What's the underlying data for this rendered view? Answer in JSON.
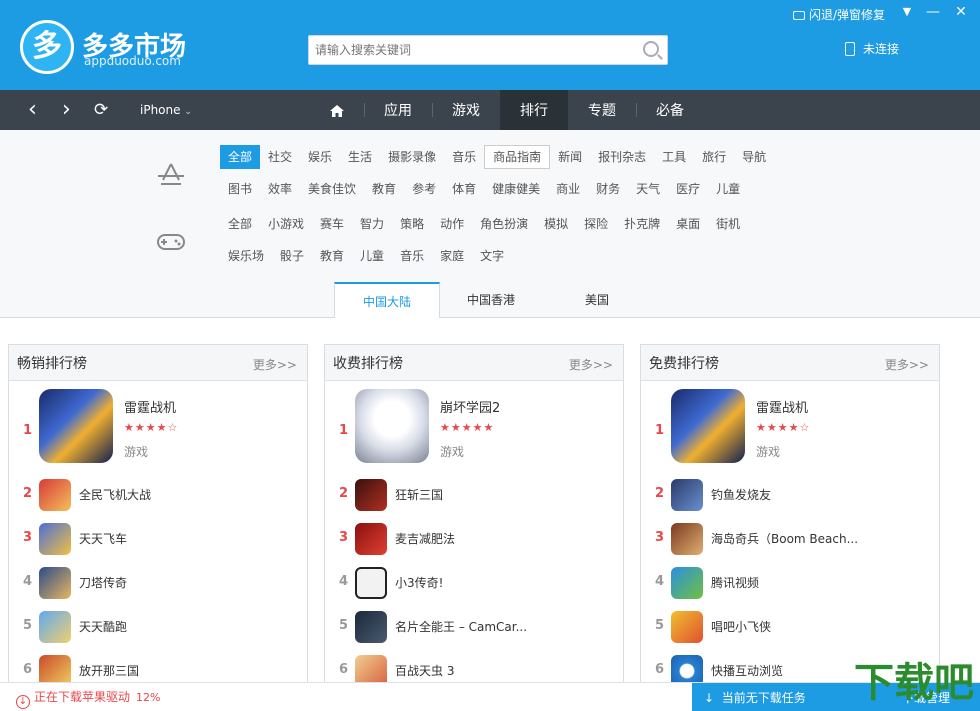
{
  "app": {
    "logo_char": "多",
    "title": "多多市场",
    "subtitle": "appduoduo.com"
  },
  "search": {
    "placeholder": "请输入搜索关键词"
  },
  "window": {
    "flash_label": "闪退/弹窗修复",
    "minimize": "—",
    "close": "✕",
    "dropdown": "▼"
  },
  "connection": {
    "label": "未连接"
  },
  "nav": {
    "device": "iPhone",
    "tabs": [
      {
        "label": ""
      },
      {
        "label": "应用"
      },
      {
        "label": "游戏"
      },
      {
        "label": "排行"
      },
      {
        "label": "专题"
      },
      {
        "label": "必备"
      }
    ]
  },
  "categories": {
    "app_row1": [
      "全部",
      "社交",
      "娱乐",
      "生活",
      "摄影录像",
      "音乐",
      "商品指南",
      "新闻",
      "报刊杂志",
      "工具",
      "旅行",
      "导航"
    ],
    "app_row2": [
      "图书",
      "效率",
      "美食佳饮",
      "教育",
      "参考",
      "体育",
      "健康健美",
      "商业",
      "财务",
      "天气",
      "医疗",
      "儿童"
    ],
    "game_row1": [
      "全部",
      "小游戏",
      "赛车",
      "智力",
      "策略",
      "动作",
      "角色扮演",
      "模拟",
      "探险",
      "扑克牌",
      "桌面",
      "街机"
    ],
    "game_row2": [
      "娱乐场",
      "骰子",
      "教育",
      "儿童",
      "音乐",
      "家庭",
      "文字"
    ]
  },
  "regions": [
    "中国大陆",
    "中国香港",
    "美国"
  ],
  "more_label": "更多>>",
  "panels": [
    {
      "title": "畅销排行榜",
      "top": {
        "rank": "1",
        "name": "雷霆战机",
        "stars": "★★★★☆",
        "category": "游戏"
      },
      "items": [
        {
          "rank": "2",
          "name": "全民飞机大战"
        },
        {
          "rank": "3",
          "name": "天天飞车"
        },
        {
          "rank": "4",
          "name": "刀塔传奇"
        },
        {
          "rank": "5",
          "name": "天天酷跑"
        },
        {
          "rank": "6",
          "name": "放开那三国"
        }
      ]
    },
    {
      "title": "收费排行榜",
      "top": {
        "rank": "1",
        "name": "崩坏学园2",
        "stars": "★★★★★",
        "category": "游戏"
      },
      "items": [
        {
          "rank": "2",
          "name": "狂斩三国"
        },
        {
          "rank": "3",
          "name": "麦吉减肥法"
        },
        {
          "rank": "4",
          "name": "小3传奇!"
        },
        {
          "rank": "5",
          "name": "名片全能王 – CamCar..."
        },
        {
          "rank": "6",
          "name": "百战天虫 3"
        }
      ]
    },
    {
      "title": "免费排行榜",
      "top": {
        "rank": "1",
        "name": "雷霆战机",
        "stars": "★★★★☆",
        "category": "游戏"
      },
      "items": [
        {
          "rank": "2",
          "name": "钓鱼发烧友"
        },
        {
          "rank": "3",
          "name": "海岛奇兵（Boom Beach..."
        },
        {
          "rank": "4",
          "name": "腾讯视频"
        },
        {
          "rank": "5",
          "name": "唱吧小飞侠"
        },
        {
          "rank": "6",
          "name": "快播互动浏览"
        }
      ]
    }
  ],
  "status": {
    "download_text": "正在下载苹果驱动",
    "percent": "12%",
    "no_task": "当前无下载任务",
    "manage": "下载管理"
  },
  "watermark": "下载吧",
  "colors": {
    "header": "#1d9be3",
    "nav": "#3b444c",
    "accent_red": "#e8484a"
  }
}
